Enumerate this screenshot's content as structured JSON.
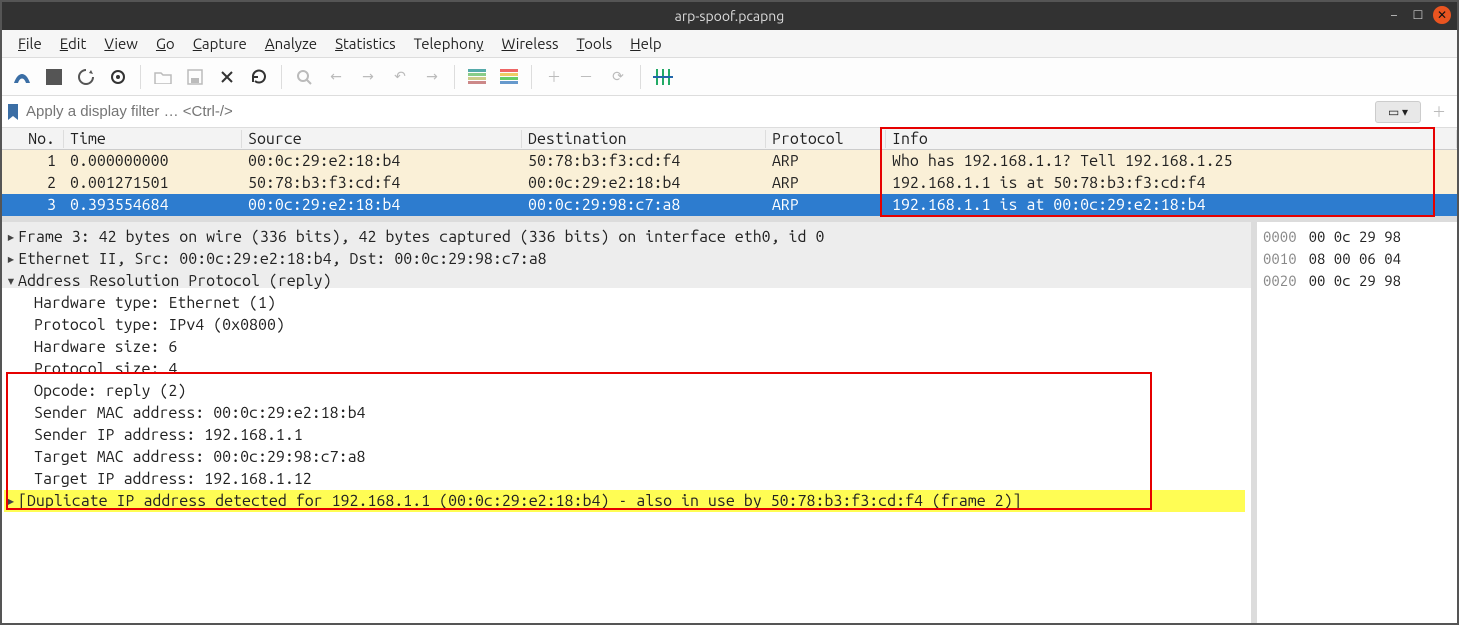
{
  "window": {
    "title": "arp-spoof.pcapng"
  },
  "menu": {
    "items": [
      "File",
      "Edit",
      "View",
      "Go",
      "Capture",
      "Analyze",
      "Statistics",
      "Telephony",
      "Wireless",
      "Tools",
      "Help"
    ]
  },
  "filter": {
    "placeholder": "Apply a display filter … <Ctrl-/>"
  },
  "columns": {
    "no": "No.",
    "time": "Time",
    "src": "Source",
    "dst": "Destination",
    "proto": "Protocol",
    "info": "Info"
  },
  "packets": [
    {
      "no": "1",
      "time": "0.000000000",
      "src": "00:0c:29:e2:18:b4",
      "dst": "50:78:b3:f3:cd:f4",
      "proto": "ARP",
      "info": "Who has 192.168.1.1? Tell 192.168.1.25"
    },
    {
      "no": "2",
      "time": "0.001271501",
      "src": "50:78:b3:f3:cd:f4",
      "dst": "00:0c:29:e2:18:b4",
      "proto": "ARP",
      "info": "192.168.1.1 is at 50:78:b3:f3:cd:f4"
    },
    {
      "no": "3",
      "time": "0.393554684",
      "src": "00:0c:29:e2:18:b4",
      "dst": "00:0c:29:98:c7:a8",
      "proto": "ARP",
      "info": "192.168.1.1 is at 00:0c:29:e2:18:b4"
    }
  ],
  "details": {
    "frame": "Frame 3: 42 bytes on wire (336 bits), 42 bytes captured (336 bits) on interface eth0, id 0",
    "eth": "Ethernet II, Src: 00:0c:29:e2:18:b4, Dst: 00:0c:29:98:c7:a8",
    "arp_header": "Address Resolution Protocol (reply)",
    "hw_type": "Hardware type: Ethernet (1)",
    "proto_type": "Protocol type: IPv4 (0x0800)",
    "hw_size": "Hardware size: 6",
    "proto_size": "Protocol size: 4",
    "opcode": "Opcode: reply (2)",
    "sender_mac": "Sender MAC address: 00:0c:29:e2:18:b4",
    "sender_ip": "Sender IP address: 192.168.1.1",
    "target_mac": "Target MAC address: 00:0c:29:98:c7:a8",
    "target_ip": "Target IP address: 192.168.1.12",
    "warn": "[Duplicate IP address detected for 192.168.1.1 (00:0c:29:e2:18:b4) - also in use by 50:78:b3:f3:cd:f4 (frame 2)]"
  },
  "hex": [
    {
      "off": "0000",
      "bytes": "00 0c 29 98"
    },
    {
      "off": "0010",
      "bytes": "08 00 06 04"
    },
    {
      "off": "0020",
      "bytes": "00 0c 29 98"
    }
  ]
}
